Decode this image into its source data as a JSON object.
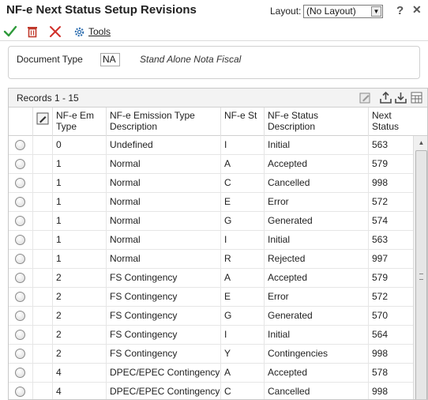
{
  "window": {
    "title": "NF-e Next Status Setup Revisions",
    "layout_label": "Layout:",
    "layout_value": "(No Layout)"
  },
  "toolbar": {
    "ok_icon": "checkmark-icon",
    "delete_icon": "trash-icon",
    "cancel_icon": "x-icon",
    "tools_label": "Tools"
  },
  "header": {
    "document_type_label": "Document Type",
    "document_type_value": "NA",
    "document_type_description": "Stand Alone Nota Fiscal"
  },
  "grid": {
    "records_label": "Records 1 - 15",
    "columns": [
      "NF-e Em Type",
      "NF-e Emission Type Description",
      "NF-e St",
      "NF-e Status Description",
      "Next Status"
    ],
    "rows": [
      {
        "em_type": "0",
        "em_desc": "Undefined",
        "st": "I",
        "st_desc": "Initial",
        "next": "563"
      },
      {
        "em_type": "1",
        "em_desc": "Normal",
        "st": "A",
        "st_desc": "Accepted",
        "next": "579"
      },
      {
        "em_type": "1",
        "em_desc": "Normal",
        "st": "C",
        "st_desc": "Cancelled",
        "next": "998"
      },
      {
        "em_type": "1",
        "em_desc": "Normal",
        "st": "E",
        "st_desc": "Error",
        "next": "572"
      },
      {
        "em_type": "1",
        "em_desc": "Normal",
        "st": "G",
        "st_desc": "Generated",
        "next": "574"
      },
      {
        "em_type": "1",
        "em_desc": "Normal",
        "st": "I",
        "st_desc": "Initial",
        "next": "563"
      },
      {
        "em_type": "1",
        "em_desc": "Normal",
        "st": "R",
        "st_desc": "Rejected",
        "next": "997"
      },
      {
        "em_type": "2",
        "em_desc": "FS Contingency",
        "st": "A",
        "st_desc": "Accepted",
        "next": "579"
      },
      {
        "em_type": "2",
        "em_desc": "FS Contingency",
        "st": "E",
        "st_desc": "Error",
        "next": "572"
      },
      {
        "em_type": "2",
        "em_desc": "FS Contingency",
        "st": "G",
        "st_desc": "Generated",
        "next": "570"
      },
      {
        "em_type": "2",
        "em_desc": "FS Contingency",
        "st": "I",
        "st_desc": "Initial",
        "next": "564"
      },
      {
        "em_type": "2",
        "em_desc": "FS Contingency",
        "st": "Y",
        "st_desc": "Contingencies",
        "next": "998"
      },
      {
        "em_type": "4",
        "em_desc": "DPEC/EPEC Contingency",
        "st": "A",
        "st_desc": "Accepted",
        "next": "578"
      },
      {
        "em_type": "4",
        "em_desc": "DPEC/EPEC Contingency",
        "st": "C",
        "st_desc": "Cancelled",
        "next": "998"
      }
    ]
  },
  "colors": {
    "ok_green": "#2e9a3a",
    "delete_red": "#c0392b",
    "cancel_red": "#d0302a",
    "tools_blue": "#2f6fb0"
  }
}
